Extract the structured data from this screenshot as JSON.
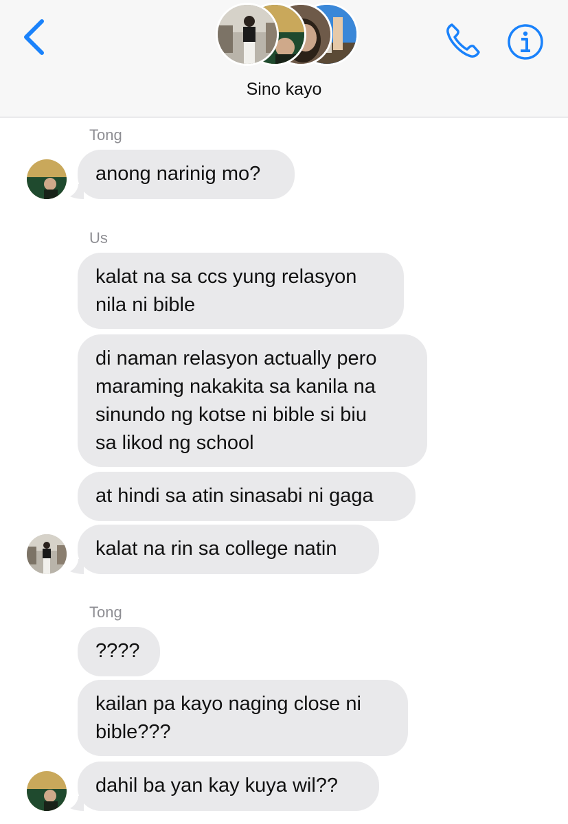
{
  "header": {
    "title": "Sino kayo",
    "back_icon": "chevron-left-icon",
    "call_icon": "phone-icon",
    "info_icon": "info-icon",
    "accent": "#1a82fb"
  },
  "messages": [
    {
      "sender": "Tong",
      "text": "anong narinig mo?"
    },
    {
      "sender": "Us",
      "text": "kalat na sa ccs yung relasyon\nnila ni bible"
    },
    {
      "text": "di naman relasyon actually pero\nmaraming nakakita sa kanila na\nsinundo ng kotse ni bible si biu\nsa likod ng school"
    },
    {
      "text": "at hindi sa atin sinasabi ni gaga"
    },
    {
      "text": "kalat na rin sa college natin"
    },
    {
      "sender": "Tong",
      "text": "????"
    },
    {
      "text": "kailan pa kayo naging close ni\nbible???"
    },
    {
      "text": "dahil ba yan kay kuya wil??"
    }
  ],
  "colors": {
    "bubble": "#e9e9eb",
    "sender": "#8e8e93"
  }
}
